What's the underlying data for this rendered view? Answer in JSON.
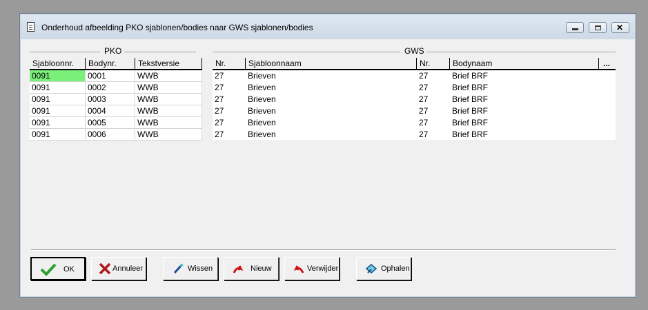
{
  "window": {
    "title": "Onderhoud afbeelding PKO sjablonen/bodies naar GWS sjablonen/bodies"
  },
  "pko": {
    "group_label": "PKO",
    "columns": [
      "Sjabloonnr.",
      "Bodynr.",
      "Tekstversie"
    ],
    "rows": [
      [
        "0091",
        "0001",
        "WWB"
      ],
      [
        "0091",
        "0002",
        "WWB"
      ],
      [
        "0091",
        "0003",
        "WWB"
      ],
      [
        "0091",
        "0004",
        "WWB"
      ],
      [
        "0091",
        "0005",
        "WWB"
      ],
      [
        "0091",
        "0006",
        "WWB"
      ]
    ]
  },
  "gws": {
    "group_label": "GWS",
    "columns": [
      "Nr.",
      "Sjabloonnaam",
      "Nr.",
      "Bodynaam",
      "..."
    ],
    "rows": [
      [
        "27",
        "Brieven",
        "27",
        "Brief BRF"
      ],
      [
        "27",
        "Brieven",
        "27",
        "Brief BRF"
      ],
      [
        "27",
        "Brieven",
        "27",
        "Brief BRF"
      ],
      [
        "27",
        "Brieven",
        "27",
        "Brief BRF"
      ],
      [
        "27",
        "Brieven",
        "27",
        "Brief BRF"
      ],
      [
        "27",
        "Brieven",
        "27",
        "Brief BRF"
      ]
    ]
  },
  "buttons": {
    "ok": "OK",
    "annuleer": "Annuleer",
    "wissen": "Wissen",
    "nieuw": "Nieuw",
    "verwijder": "Verwijder",
    "ophalen": "Ophalen"
  },
  "colors": {
    "selected_cell": "#7af07a",
    "ok_check": "#2e9e2e",
    "cancel_x": "#b01818",
    "red_arrow": "#d01010"
  }
}
